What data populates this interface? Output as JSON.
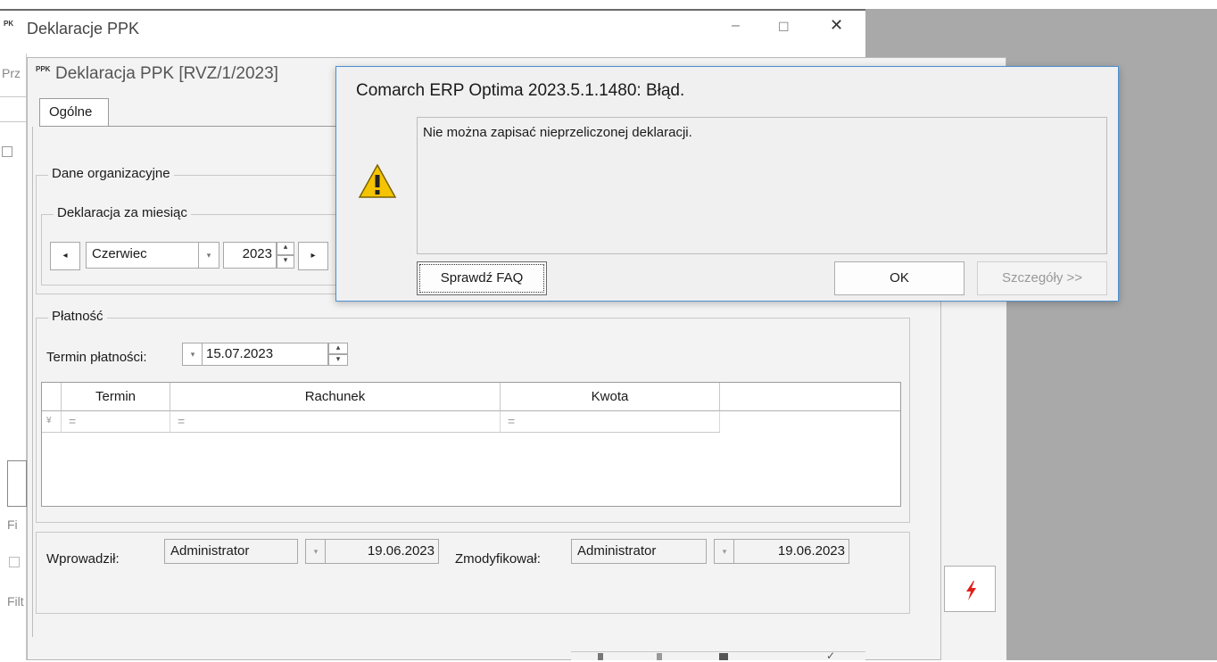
{
  "outer_window": {
    "icon_text": "PK",
    "title": "Deklaracje PPK",
    "left_cut_text": "Prz",
    "left_cut_fi1": "Fi",
    "left_cut_fi2": "Filt"
  },
  "inner_window": {
    "icon_text": "PPK",
    "title": "Deklaracja PPK [RVZ/1/2023]",
    "tab_label": "Ogólne",
    "org_group_label": "Dane organizacyjne",
    "month_group_label": "Deklaracja za miesiąc",
    "month_value": "Czerwiec",
    "year_value": "2023",
    "payment_group_label": "Płatność",
    "payment_due_label": "Termin płatności:",
    "payment_due_value": "15.07.2023",
    "table": {
      "headers": [
        "Termin",
        "Rachunek",
        "Kwota"
      ],
      "filter_symbol": "="
    },
    "entered_by_label": "Wprowadził:",
    "entered_by_value": "Administrator",
    "entered_date": "19.06.2023",
    "modified_by_label": "Zmodyfikował:",
    "modified_by_value": "Administrator",
    "modified_date": "19.06.2023"
  },
  "dialog": {
    "title": "Comarch ERP Optima 2023.5.1.1480: Błąd.",
    "message": "Nie można zapisać nieprzeliczonej deklaracji.",
    "faq_button": "Sprawdź FAQ",
    "ok_button": "OK",
    "details_button": "Szczegóły >>"
  },
  "colors": {
    "dialog_border": "#4a8fd0",
    "warning_yellow": "#f5c400",
    "red_icon": "#e0201b"
  }
}
